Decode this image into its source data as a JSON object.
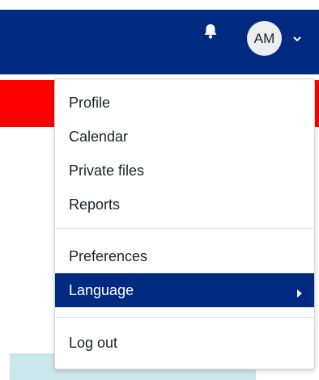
{
  "colors": {
    "navbar": "#002a80",
    "alert": "#ff0000",
    "active_item": "#002a80",
    "light_block": "#cce7ec"
  },
  "header": {
    "notifications_icon": "bell-icon",
    "user_initials": "AM",
    "user_menu_icon": "chevron-down-icon"
  },
  "user_menu": {
    "items": [
      {
        "label": "Profile"
      },
      {
        "label": "Calendar"
      },
      {
        "label": "Private files"
      },
      {
        "label": "Reports"
      },
      {
        "label": "Preferences"
      },
      {
        "label": "Language",
        "active": true,
        "submenu_icon": "caret-right-icon"
      },
      {
        "label": "Log out"
      }
    ]
  }
}
